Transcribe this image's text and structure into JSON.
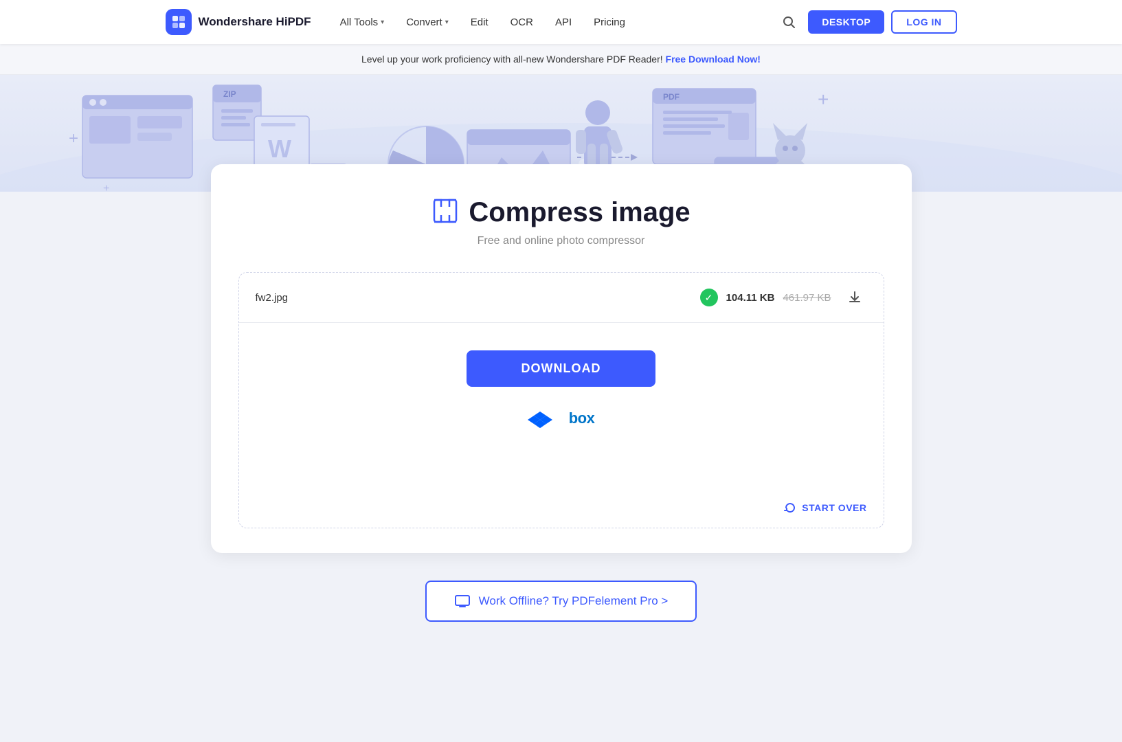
{
  "navbar": {
    "logo_text": "Wondershare HiPDF",
    "nav_items": [
      {
        "label": "All Tools",
        "has_chevron": true
      },
      {
        "label": "Convert",
        "has_chevron": true
      },
      {
        "label": "Edit",
        "has_chevron": false
      },
      {
        "label": "OCR",
        "has_chevron": false
      },
      {
        "label": "API",
        "has_chevron": false
      },
      {
        "label": "Pricing",
        "has_chevron": false
      }
    ],
    "btn_desktop": "DESKTOP",
    "btn_login": "LOG IN"
  },
  "banner": {
    "text": "Level up your work proficiency with all-new Wondershare PDF Reader!",
    "link_text": "Free Download Now!"
  },
  "tool": {
    "title": "Compress image",
    "subtitle": "Free and online photo compressor",
    "title_icon": "⊡"
  },
  "file": {
    "name": "fw2.jpg",
    "size_new": "104.11 KB",
    "size_old": "461.97 KB"
  },
  "actions": {
    "download_label": "DOWNLOAD",
    "start_over_label": "START OVER",
    "offline_label": "Work Offline? Try PDFelement Pro >"
  },
  "cloud": {
    "dropbox_label": "Dropbox",
    "box_label": "box"
  }
}
